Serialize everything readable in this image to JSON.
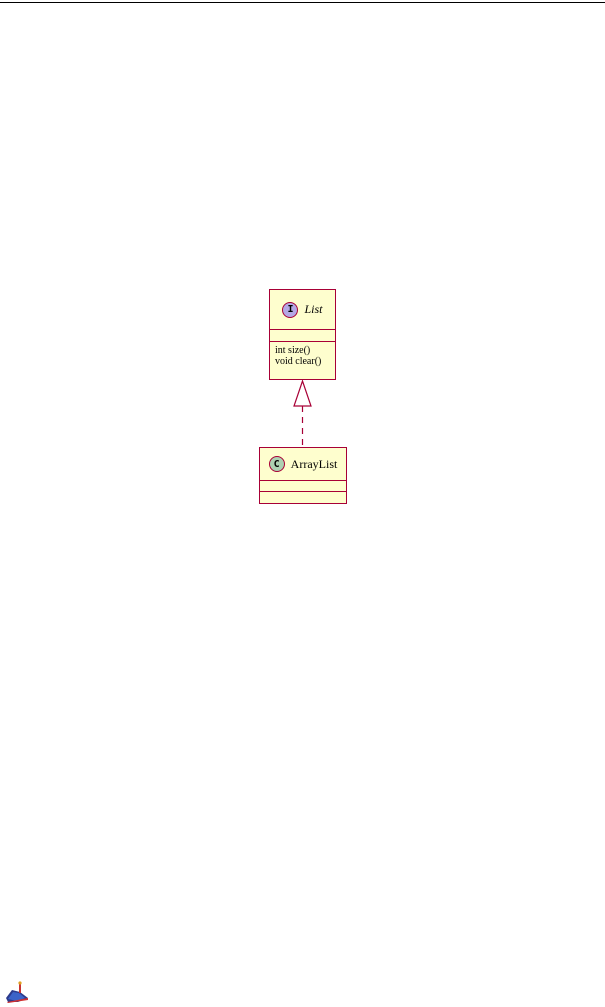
{
  "diagram": {
    "interface": {
      "stereotype_letter": "I",
      "name": "List",
      "methods": [
        "int size()",
        "void clear()"
      ]
    },
    "class": {
      "stereotype_letter": "C",
      "name": "ArrayList"
    },
    "relationship": "realization",
    "colors": {
      "box_fill": "#fefece",
      "border": "#a80036",
      "interface_circle": "#b4a7e5",
      "class_circle": "#add1b2"
    }
  },
  "logo": {
    "icon": "application-logo-icon"
  }
}
